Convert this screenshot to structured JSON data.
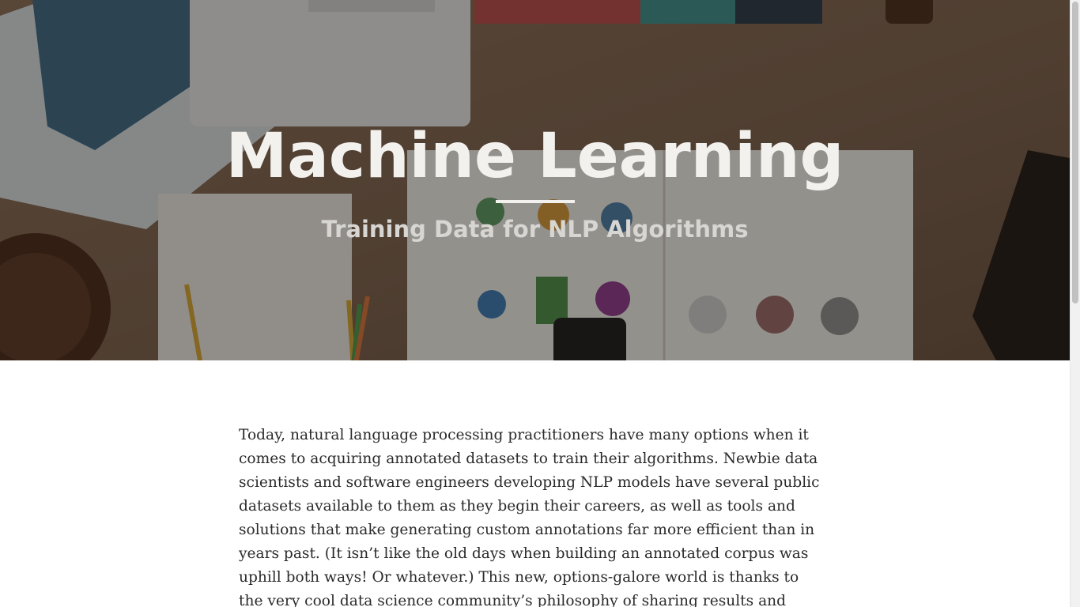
{
  "hero": {
    "title": "Machine Learning",
    "subtitle": "Training Data for NLP Algorithms",
    "background_description_icons": [
      "desk-photo"
    ],
    "overlay_color": "#140e0a"
  },
  "article": {
    "intro_paragraph": "Today, natural language processing practitioners have many options when it comes to acquiring annotated datasets to train their algorithms. Newbie data scientists and software engineers developing NLP models have several public datasets available to them as they begin their careers, as well as tools and solutions that make generating custom annotations far more efficient than in years past. (It isn’t like the old days when building an annotated corpus was uphill both ways! Or whatever.) This new, options-galore world is thanks to the very cool data science community’s philosophy of sharing results and making"
  },
  "colors": {
    "title_text": "#f3f1ee",
    "subtitle_text": "#d8d6d2",
    "body_text": "#2a2a2a"
  }
}
